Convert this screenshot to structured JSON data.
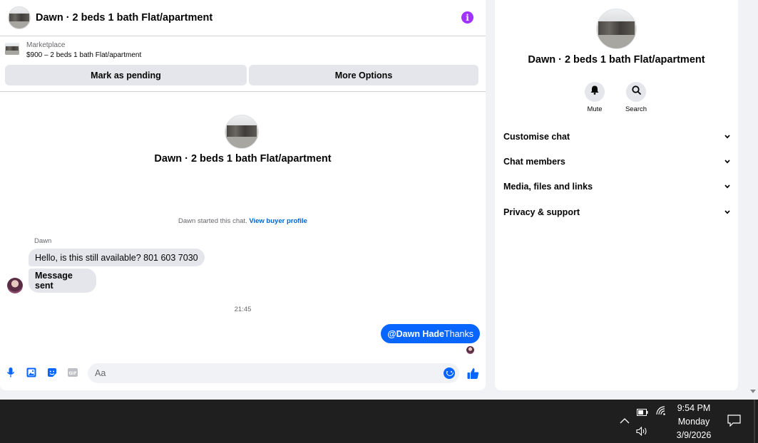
{
  "chat": {
    "header_title": "Dawn · 2 beds 1 bath Flat/apartment",
    "listing": {
      "source_label": "Marketplace",
      "price_title": "$900 – 2 beds 1 bath Flat/apartment",
      "mark_pending_label": "Mark as pending",
      "more_options_label": "More Options"
    },
    "intro_title": "Dawn · 2 beds 1 bath Flat/apartment",
    "started_text": "Dawn started this chat.",
    "view_profile_link": "View buyer profile",
    "sender_name": "Dawn",
    "messages_in": [
      "Hello, is this still available? 801 603 7030",
      "Message sent"
    ],
    "time_separator": "21:45",
    "message_out": {
      "mention": "@Dawn Hade",
      "text": "Thanks"
    },
    "composer_placeholder": "Aa"
  },
  "info_panel": {
    "title": "Dawn · 2 beds 1 bath Flat/apartment",
    "mute_label": "Mute",
    "search_label": "Search",
    "sections": [
      "Customise chat",
      "Chat members",
      "Media, files and links",
      "Privacy & support"
    ]
  },
  "taskbar": {
    "time": "9:54 PM",
    "day": "Monday",
    "date": "3/9/2026"
  },
  "colors": {
    "accent_blue": "#0866ff",
    "info_purple": "#a033ff",
    "bubble_gray": "#e4e6eb",
    "taskbar_bg": "#1f1f1f"
  },
  "icons": [
    "info-icon",
    "microphone-icon",
    "image-icon",
    "sticker-icon",
    "gif-icon",
    "emoji-icon",
    "thumbs-up-icon",
    "bell-icon",
    "search-icon",
    "chevron-down-icon",
    "battery-icon",
    "wifi-icon",
    "volume-icon",
    "notification-icon"
  ]
}
